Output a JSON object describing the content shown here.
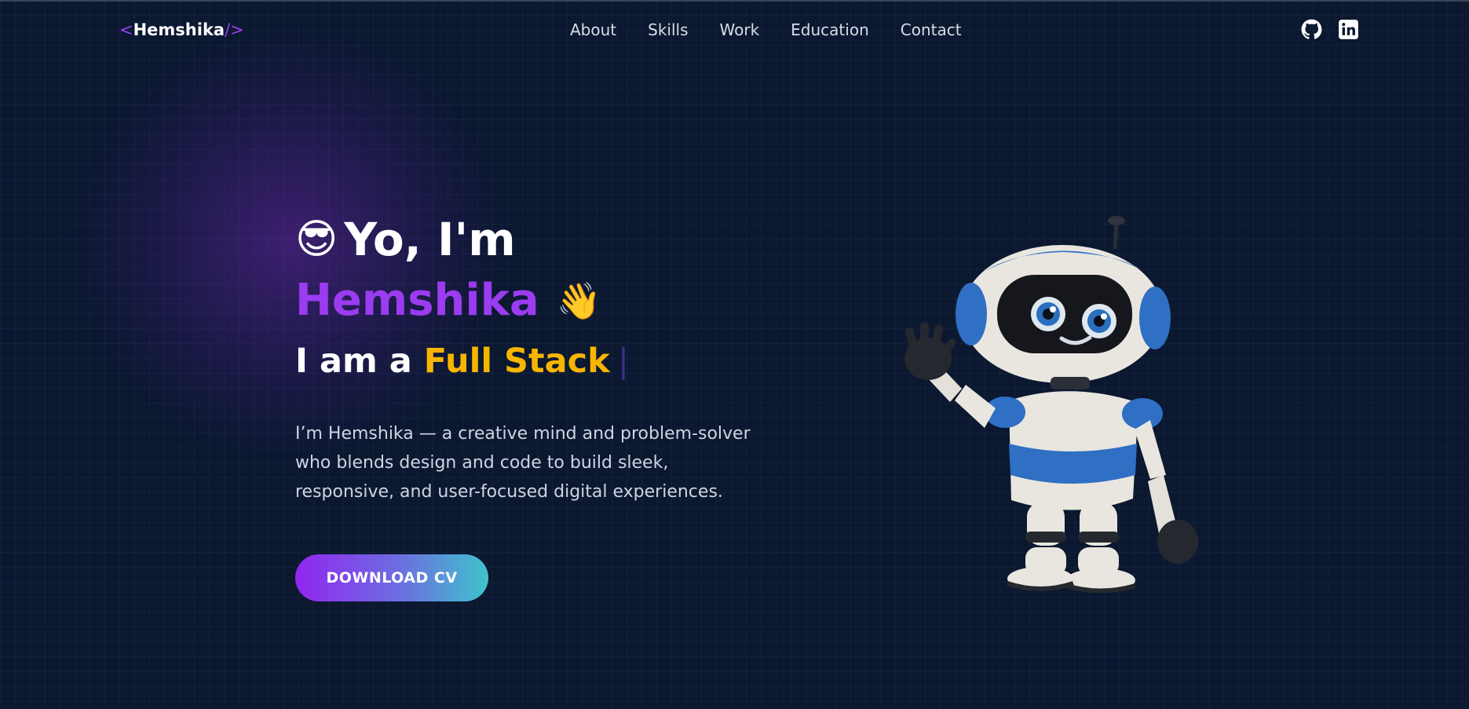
{
  "nav": {
    "logo": {
      "open": "<",
      "name": "Hemshika",
      "close": "/>"
    },
    "links": [
      "About",
      "Skills",
      "Work",
      "Education",
      "Contact"
    ],
    "socials": [
      "github-icon",
      "linkedin-icon"
    ]
  },
  "hero": {
    "greeting_emoji": "😎",
    "greeting": "Yo, I'm",
    "name": "Hemshika",
    "wave_emoji": "👋",
    "role_prefix": "I am a ",
    "role_highlight": "Full Stack",
    "cursor": "|",
    "description": "I’m Hemshika — a creative mind and problem-solver who blends design and code to build sleek, responsive, and user-focused digital experiences.",
    "cta": "DOWNLOAD CV"
  },
  "colors": {
    "background": "#0b1830",
    "accent_purple": "#9b3cf0",
    "accent_yellow": "#f7b500",
    "button_gradient_start": "#9226f0",
    "button_gradient_end": "#3fc4cc"
  },
  "illustration": "robot-mascot"
}
